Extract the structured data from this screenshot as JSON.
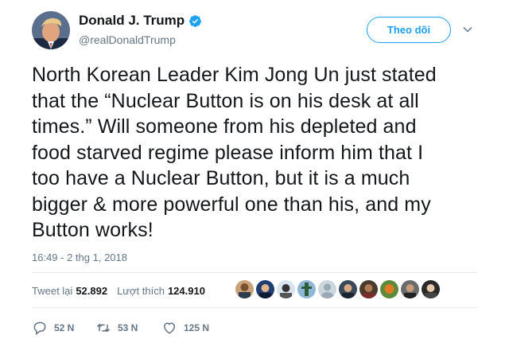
{
  "author": {
    "name": "Donald J. Trump",
    "handle": "@realDonaldTrump",
    "verified": true
  },
  "follow_button": {
    "label": "Theo dõi"
  },
  "tweet": {
    "text": "North Korean Leader Kim Jong Un just stated\nthat the “Nuclear Button is on his desk at all\ntimes.” Will someone from his depleted and\nfood starved regime please inform him that I\ntoo have a Nuclear Button, but it is a much\nbigger & more powerful one than his, and my\nButton works!",
    "timestamp": "16:49 - 2 thg 1, 2018"
  },
  "stats": {
    "retweets_label": "Tweet lại",
    "retweets_value": "52.892",
    "likes_label": "Lượt thích",
    "likes_value": "124.910"
  },
  "actions": {
    "reply_count": "52 N",
    "retweet_count": "53 N",
    "like_count": "125 N"
  },
  "colors": {
    "accent": "#1da1f2",
    "secondary_text": "#657786",
    "primary_text": "#14171a",
    "divider": "#e6ecf0"
  }
}
